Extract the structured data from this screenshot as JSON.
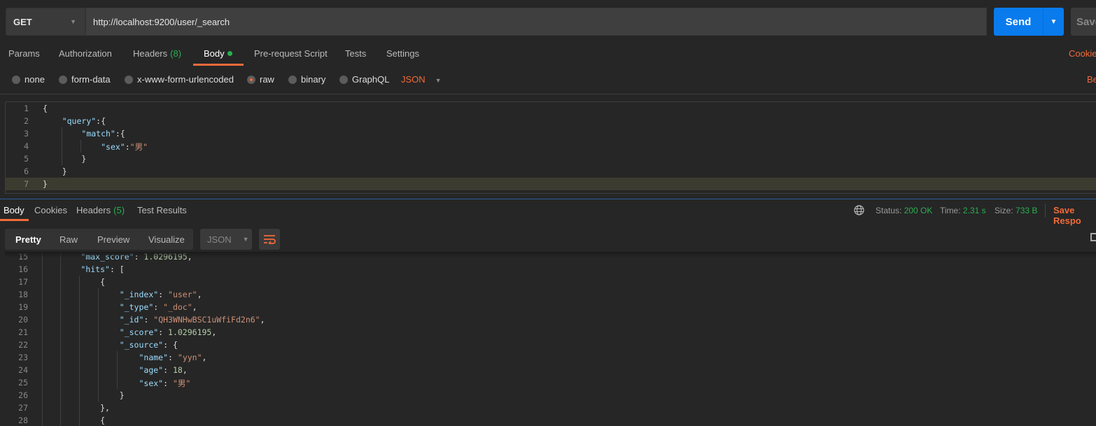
{
  "request": {
    "method": "GET",
    "url": "http://localhost:9200/user/_search",
    "send_label": "Send",
    "save_label": "Save"
  },
  "colors": {
    "accent": "#f26b3a",
    "send": "#097bed",
    "success": "#26b050"
  },
  "req_tabs": [
    {
      "label": "Params"
    },
    {
      "label": "Authorization"
    },
    {
      "label": "Headers",
      "count": "(8)"
    },
    {
      "label": "Body",
      "active": true
    },
    {
      "label": "Pre-request Script"
    },
    {
      "label": "Tests"
    },
    {
      "label": "Settings"
    }
  ],
  "cookies_label": "Cookie",
  "beautify_label": "Be",
  "body_types": [
    {
      "label": "none"
    },
    {
      "label": "form-data"
    },
    {
      "label": "x-www-form-urlencoded"
    },
    {
      "label": "raw",
      "selected": true
    },
    {
      "label": "binary"
    },
    {
      "label": "GraphQL"
    }
  ],
  "raw_format": "JSON",
  "request_body": [
    [
      [
        "p",
        "{"
      ]
    ],
    [
      [
        "p",
        "    "
      ],
      [
        "k",
        "\"query\""
      ],
      [
        "p",
        ":{"
      ]
    ],
    [
      [
        "p",
        "        "
      ],
      [
        "k",
        "\"match\""
      ],
      [
        "p",
        ":{"
      ]
    ],
    [
      [
        "p",
        "            "
      ],
      [
        "k",
        "\"sex\""
      ],
      [
        "p",
        ":"
      ],
      [
        "s",
        "\"男\""
      ]
    ],
    [
      [
        "p",
        "        }"
      ]
    ],
    [
      [
        "p",
        "    }"
      ]
    ],
    [
      [
        "p",
        "}"
      ]
    ]
  ],
  "resp_tabs": [
    {
      "label": "Body",
      "active": true
    },
    {
      "label": "Cookies"
    },
    {
      "label": "Headers",
      "count": "(5)"
    },
    {
      "label": "Test Results"
    }
  ],
  "status": {
    "status_label": "Status:",
    "status": "200 OK",
    "time_label": "Time:",
    "time": "2.31 s",
    "size_label": "Size:",
    "size": "733 B",
    "save_response": "Save Respo"
  },
  "view_modes": [
    "Pretty",
    "Raw",
    "Preview",
    "Visualize"
  ],
  "resp_format": "JSON",
  "response_start_line": 15,
  "response_body": [
    [
      [
        "p",
        "        "
      ],
      [
        "k",
        "\"max_score\""
      ],
      [
        "p",
        ": "
      ],
      [
        "n",
        "1.0296195"
      ],
      [
        "p",
        ","
      ]
    ],
    [
      [
        "p",
        "        "
      ],
      [
        "k",
        "\"hits\""
      ],
      [
        "p",
        ": ["
      ]
    ],
    [
      [
        "p",
        "            {"
      ]
    ],
    [
      [
        "p",
        "                "
      ],
      [
        "k",
        "\"_index\""
      ],
      [
        "p",
        ": "
      ],
      [
        "s",
        "\"user\""
      ],
      [
        "p",
        ","
      ]
    ],
    [
      [
        "p",
        "                "
      ],
      [
        "k",
        "\"_type\""
      ],
      [
        "p",
        ": "
      ],
      [
        "s",
        "\"_doc\""
      ],
      [
        "p",
        ","
      ]
    ],
    [
      [
        "p",
        "                "
      ],
      [
        "k",
        "\"_id\""
      ],
      [
        "p",
        ": "
      ],
      [
        "s",
        "\"QH3WNHwBSC1uWfiFd2n6\""
      ],
      [
        "p",
        ","
      ]
    ],
    [
      [
        "p",
        "                "
      ],
      [
        "k",
        "\"_score\""
      ],
      [
        "p",
        ": "
      ],
      [
        "n",
        "1.0296195"
      ],
      [
        "p",
        ","
      ]
    ],
    [
      [
        "p",
        "                "
      ],
      [
        "k",
        "\"_source\""
      ],
      [
        "p",
        ": {"
      ]
    ],
    [
      [
        "p",
        "                    "
      ],
      [
        "k",
        "\"name\""
      ],
      [
        "p",
        ": "
      ],
      [
        "s",
        "\"yyn\""
      ],
      [
        "p",
        ","
      ]
    ],
    [
      [
        "p",
        "                    "
      ],
      [
        "k",
        "\"age\""
      ],
      [
        "p",
        ": "
      ],
      [
        "n",
        "18"
      ],
      [
        "p",
        ","
      ]
    ],
    [
      [
        "p",
        "                    "
      ],
      [
        "k",
        "\"sex\""
      ],
      [
        "p",
        ": "
      ],
      [
        "s",
        "\"男\""
      ]
    ],
    [
      [
        "p",
        "                }"
      ]
    ],
    [
      [
        "p",
        "            },"
      ]
    ],
    [
      [
        "p",
        "            {"
      ]
    ]
  ]
}
